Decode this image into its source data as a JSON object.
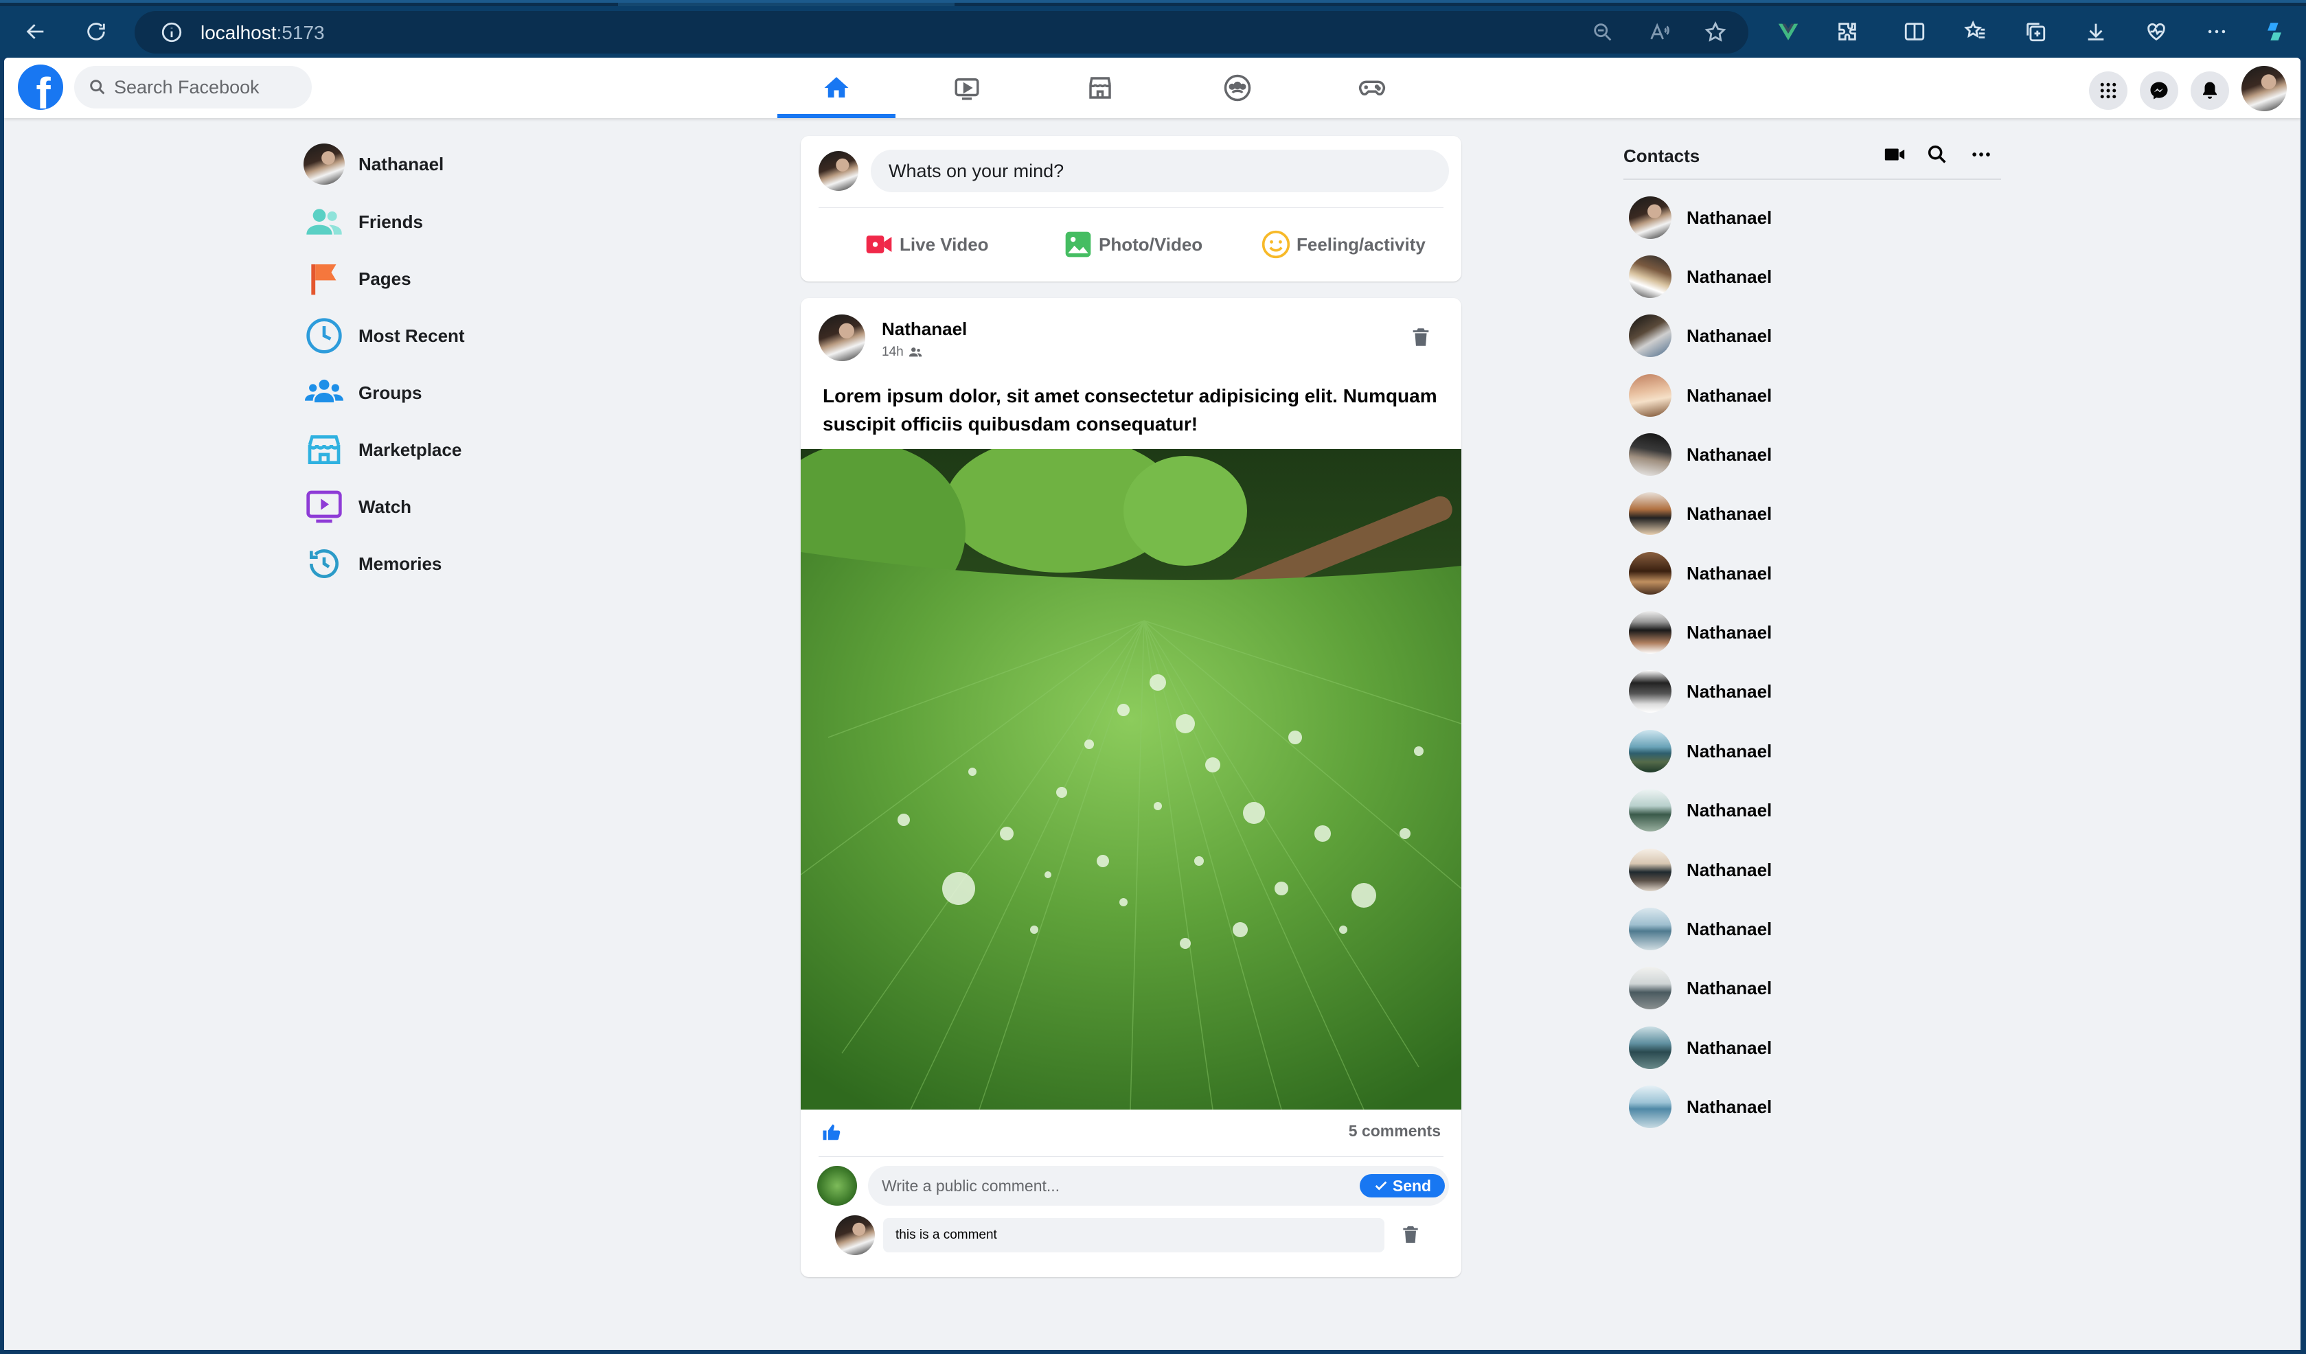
{
  "browser": {
    "url_host": "localhost",
    "url_port": ":5173"
  },
  "header": {
    "search_placeholder": "Search Facebook",
    "nav_tabs": [
      "home-icon",
      "watch-icon",
      "marketplace-icon",
      "groups-icon",
      "gaming-icon"
    ],
    "active_tab": "home-icon"
  },
  "sidebar": {
    "items": [
      {
        "label": "Nathanael",
        "icon": "avatar"
      },
      {
        "label": "Friends",
        "icon": "friends-icon"
      },
      {
        "label": "Pages",
        "icon": "flag-icon"
      },
      {
        "label": "Most Recent",
        "icon": "clock-icon"
      },
      {
        "label": "Groups",
        "icon": "groups-icon"
      },
      {
        "label": "Marketplace",
        "icon": "store-icon"
      },
      {
        "label": "Watch",
        "icon": "play-icon"
      },
      {
        "label": "Memories",
        "icon": "history-icon"
      }
    ]
  },
  "composer": {
    "placeholder": "Whats on your mind?",
    "live_video": "Live Video",
    "photo_video": "Photo/Video",
    "feeling": "Feeling/activity"
  },
  "post": {
    "author": "Nathanael",
    "time": "14h",
    "text": "Lorem ipsum dolor, sit amet consectetur adipisicing elit. Numquam suscipit officiis quibusdam consequatur!",
    "comments_count": "5 comments",
    "comment_placeholder": "Write a public comment...",
    "send_label": "Send",
    "comments": [
      {
        "text": "this is a comment"
      }
    ]
  },
  "contacts": {
    "title": "Contacts",
    "list": [
      "Nathanael",
      "Nathanael",
      "Nathanael",
      "Nathanael",
      "Nathanael",
      "Nathanael",
      "Nathanael",
      "Nathanael",
      "Nathanael",
      "Nathanael",
      "Nathanael",
      "Nathanael",
      "Nathanael",
      "Nathanael",
      "Nathanael",
      "Nathanael"
    ]
  },
  "colors": {
    "brand": "#1877f2",
    "background": "#f0f2f5",
    "live_video": "#f02849",
    "photo": "#45bd62",
    "feeling": "#f7b928"
  }
}
